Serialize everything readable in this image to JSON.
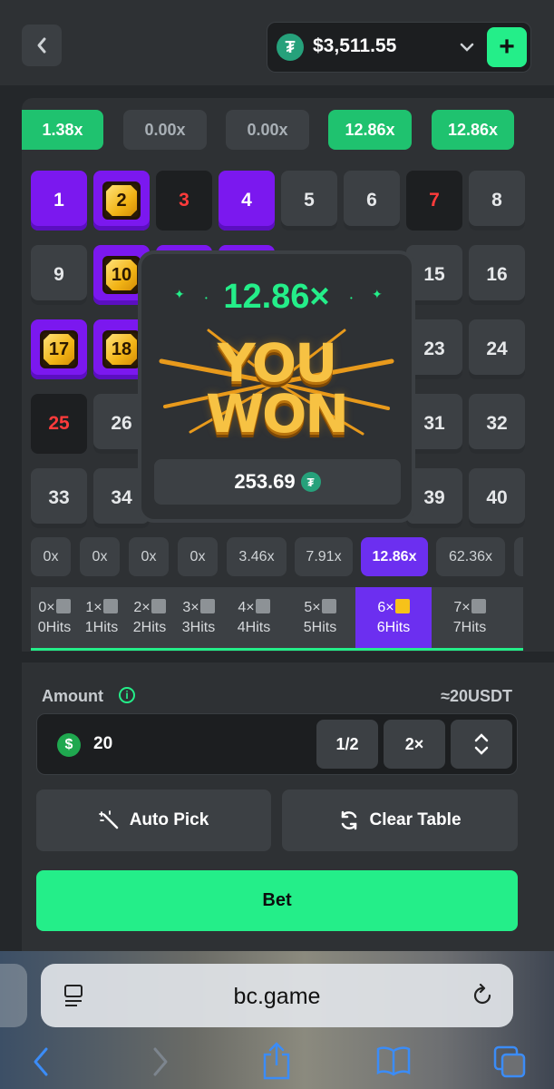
{
  "header": {
    "balance": "$3,511.55",
    "currency_icon": "tether-icon",
    "add_label": "+"
  },
  "history": [
    "1.38x",
    "0.00x",
    "0.00x",
    "12.86x",
    "12.86x"
  ],
  "board": {
    "numbers": [
      "1",
      "2",
      "3",
      "4",
      "5",
      "6",
      "7",
      "8",
      "9",
      "10",
      "15",
      "16",
      "17",
      "18",
      "23",
      "24",
      "25",
      "26",
      "31",
      "32",
      "33",
      "34",
      "39",
      "40"
    ]
  },
  "multipliers": [
    "0x",
    "0x",
    "0x",
    "0x",
    "3.46x",
    "7.91x",
    "12.86x",
    "62.36x"
  ],
  "hits": [
    {
      "top": "0×",
      "bottom": "0Hits"
    },
    {
      "top": "1×",
      "bottom": "1Hits"
    },
    {
      "top": "2×",
      "bottom": "2Hits"
    },
    {
      "top": "3×",
      "bottom": "3Hits"
    },
    {
      "top": "4×",
      "bottom": "4Hits"
    },
    {
      "top": "5×",
      "bottom": "5Hits"
    },
    {
      "top": "6×",
      "bottom": "6Hits"
    },
    {
      "top": "7×",
      "bottom": "7Hits"
    }
  ],
  "popup": {
    "multiplier": "12.86×",
    "line1": "YOU",
    "line2": "WON",
    "amount": "253.69"
  },
  "controls": {
    "amount_label": "Amount",
    "approx": "≈20USDT",
    "amount_value": "20",
    "half": "1/2",
    "double": "2×",
    "auto_pick": "Auto Pick",
    "clear_table": "Clear Table",
    "bet": "Bet"
  },
  "browser": {
    "url": "bc.game"
  },
  "colors": {
    "accent_green": "#24ee89",
    "purple": "#7b18ef",
    "gold": "#f6c21a"
  }
}
